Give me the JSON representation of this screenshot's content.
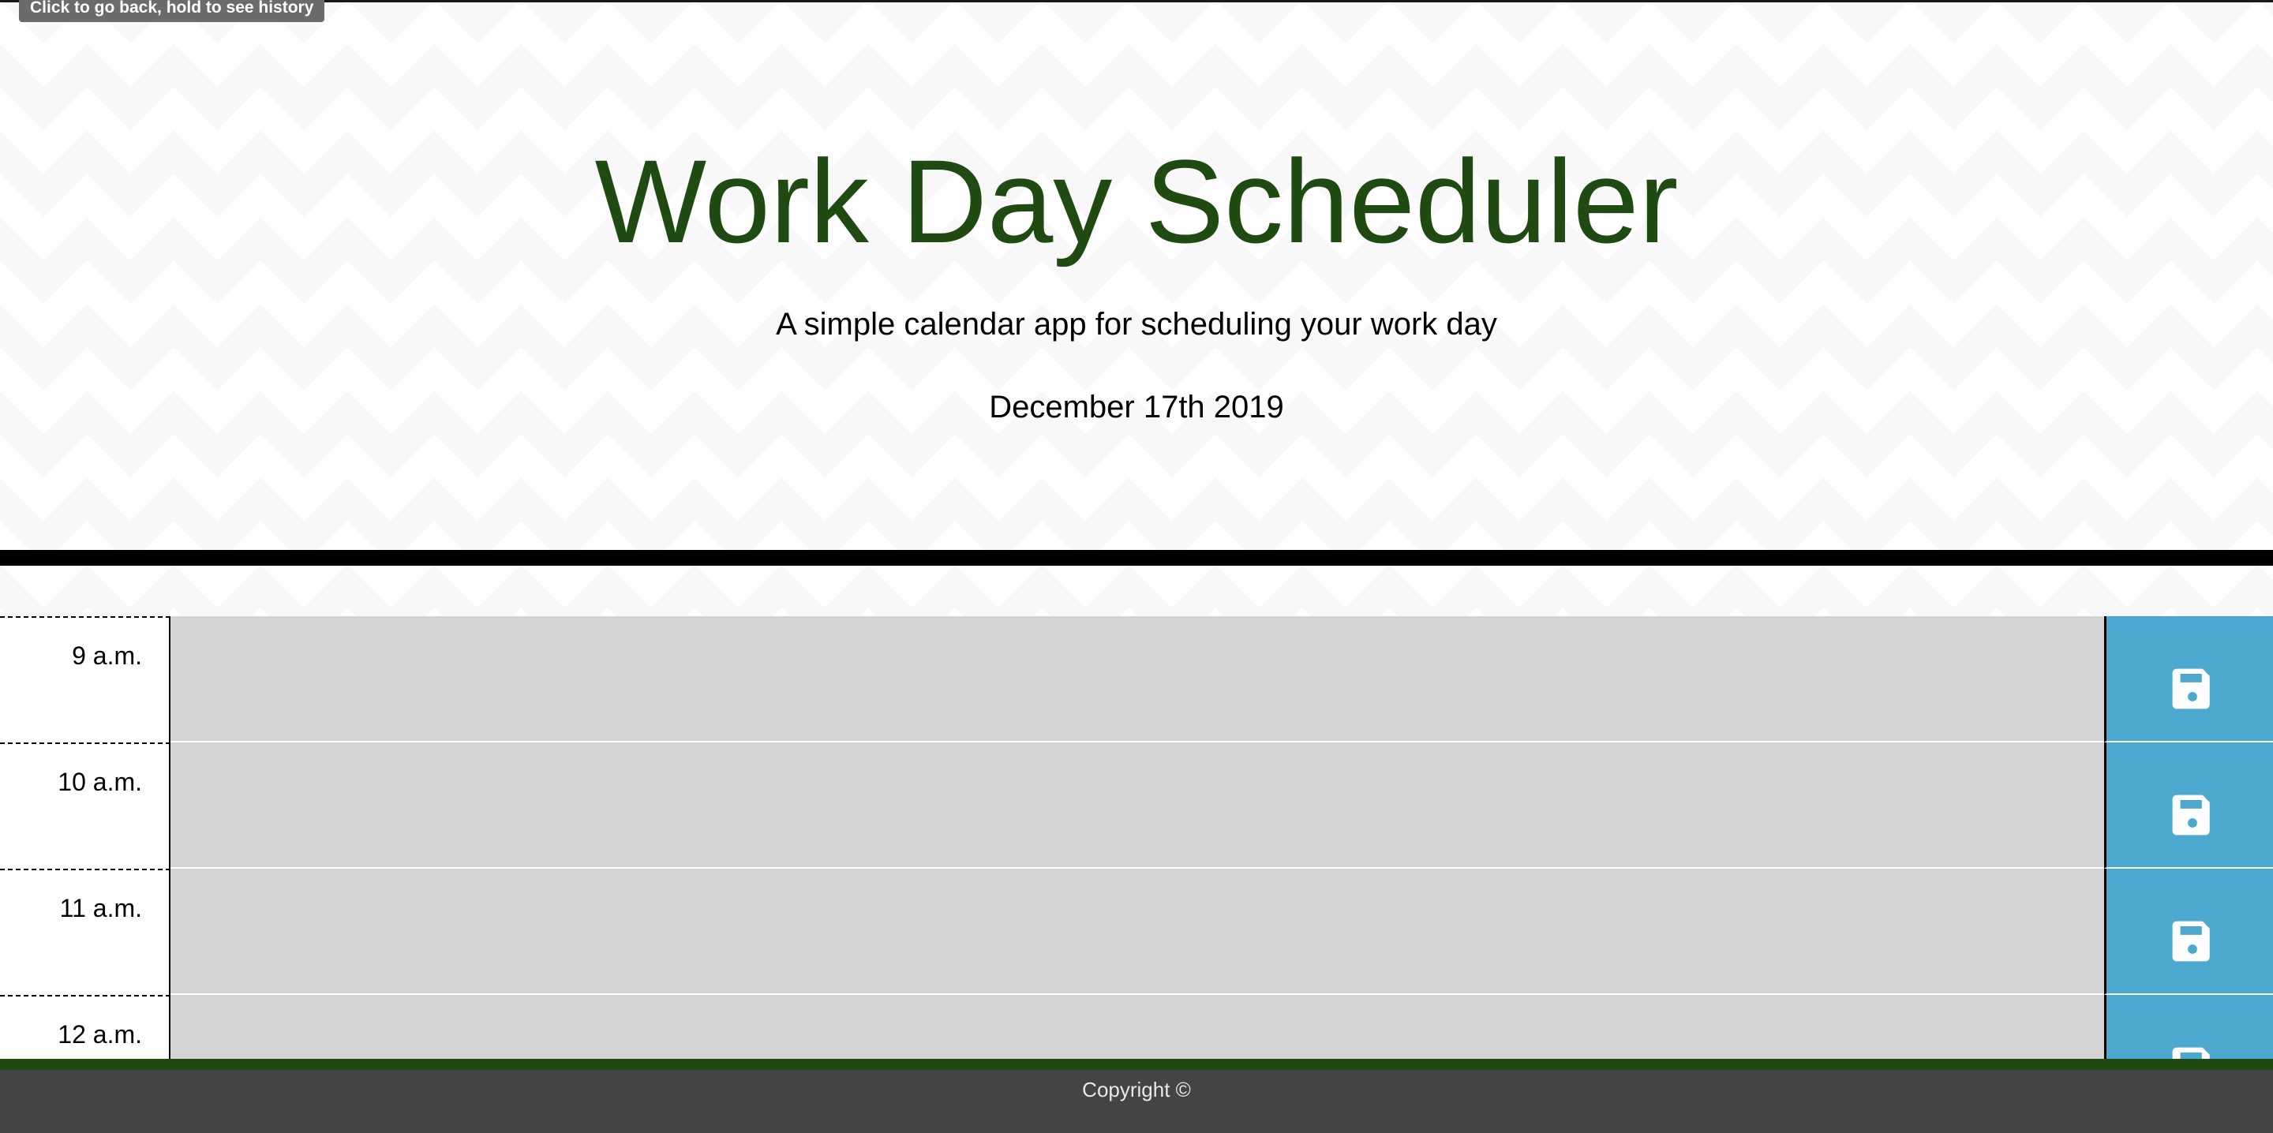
{
  "browser": {
    "back_tooltip": "Click to go back, hold to see history"
  },
  "header": {
    "title": "Work Day Scheduler",
    "lead": "A simple calendar app for scheduling your work day",
    "current_day": "December 17th 2019"
  },
  "schedule": {
    "rows": [
      {
        "hour": "9 a.m.",
        "description": "",
        "save_icon": "floppy-disk-icon"
      },
      {
        "hour": "10 a.m.",
        "description": "",
        "save_icon": "floppy-disk-icon"
      },
      {
        "hour": "11 a.m.",
        "description": "",
        "save_icon": "floppy-disk-icon"
      },
      {
        "hour": "12 a.m.",
        "description": "",
        "save_icon": "floppy-disk-icon"
      }
    ]
  },
  "footer": {
    "copyright": "Copyright ©"
  },
  "colors": {
    "title": "#1f4a12",
    "row_background": "#d3d3d3",
    "save_button": "#4da8d0",
    "footer_background": "#444444",
    "footer_border": "#1f4a12"
  }
}
